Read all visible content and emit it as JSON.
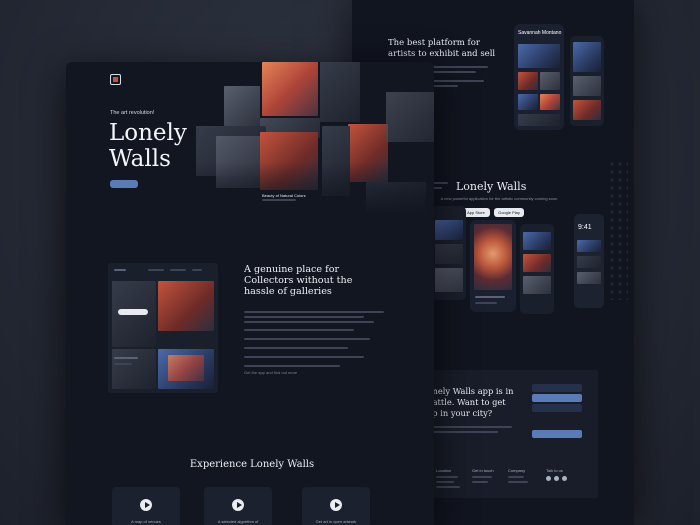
{
  "back_page": {
    "headline": "The best platform for artists to exhibit and sell",
    "phone_profile_name": "Savannah Montano",
    "mid_title": "Lonely Walls",
    "mid_subtitle": "A new powerful application for the artistic community coming soon",
    "app_store_label": "App Store",
    "google_play_label": "Google Play",
    "time_label": "9:41"
  },
  "hero": {
    "eyebrow": "The art revolution!",
    "title_line1": "Lonely",
    "title_line2": "Walls",
    "artwork_caption": "Beauty of Natural Colors"
  },
  "section_collectors": {
    "headline": "A genuine place for Collectors without the hassle of galleries",
    "link_text": "Get the app and find out more"
  },
  "seattle_block": {
    "headline": "Lonely Walls app is in Seattle. Want to get app in your city?"
  },
  "footer": {
    "columns": [
      "Location",
      "Get in touch",
      "Company",
      "Talk to us"
    ]
  },
  "experience": {
    "title": "Experience Lonely Walls",
    "videos": [
      "A map of venues",
      "A selected algorithm of",
      "Get art in open artwork"
    ]
  },
  "colors": {
    "page_bg": "#262b37",
    "sheet_bg": "#121621",
    "accent_blue": "#5b7bb6",
    "accent_red": "#c4533d"
  }
}
